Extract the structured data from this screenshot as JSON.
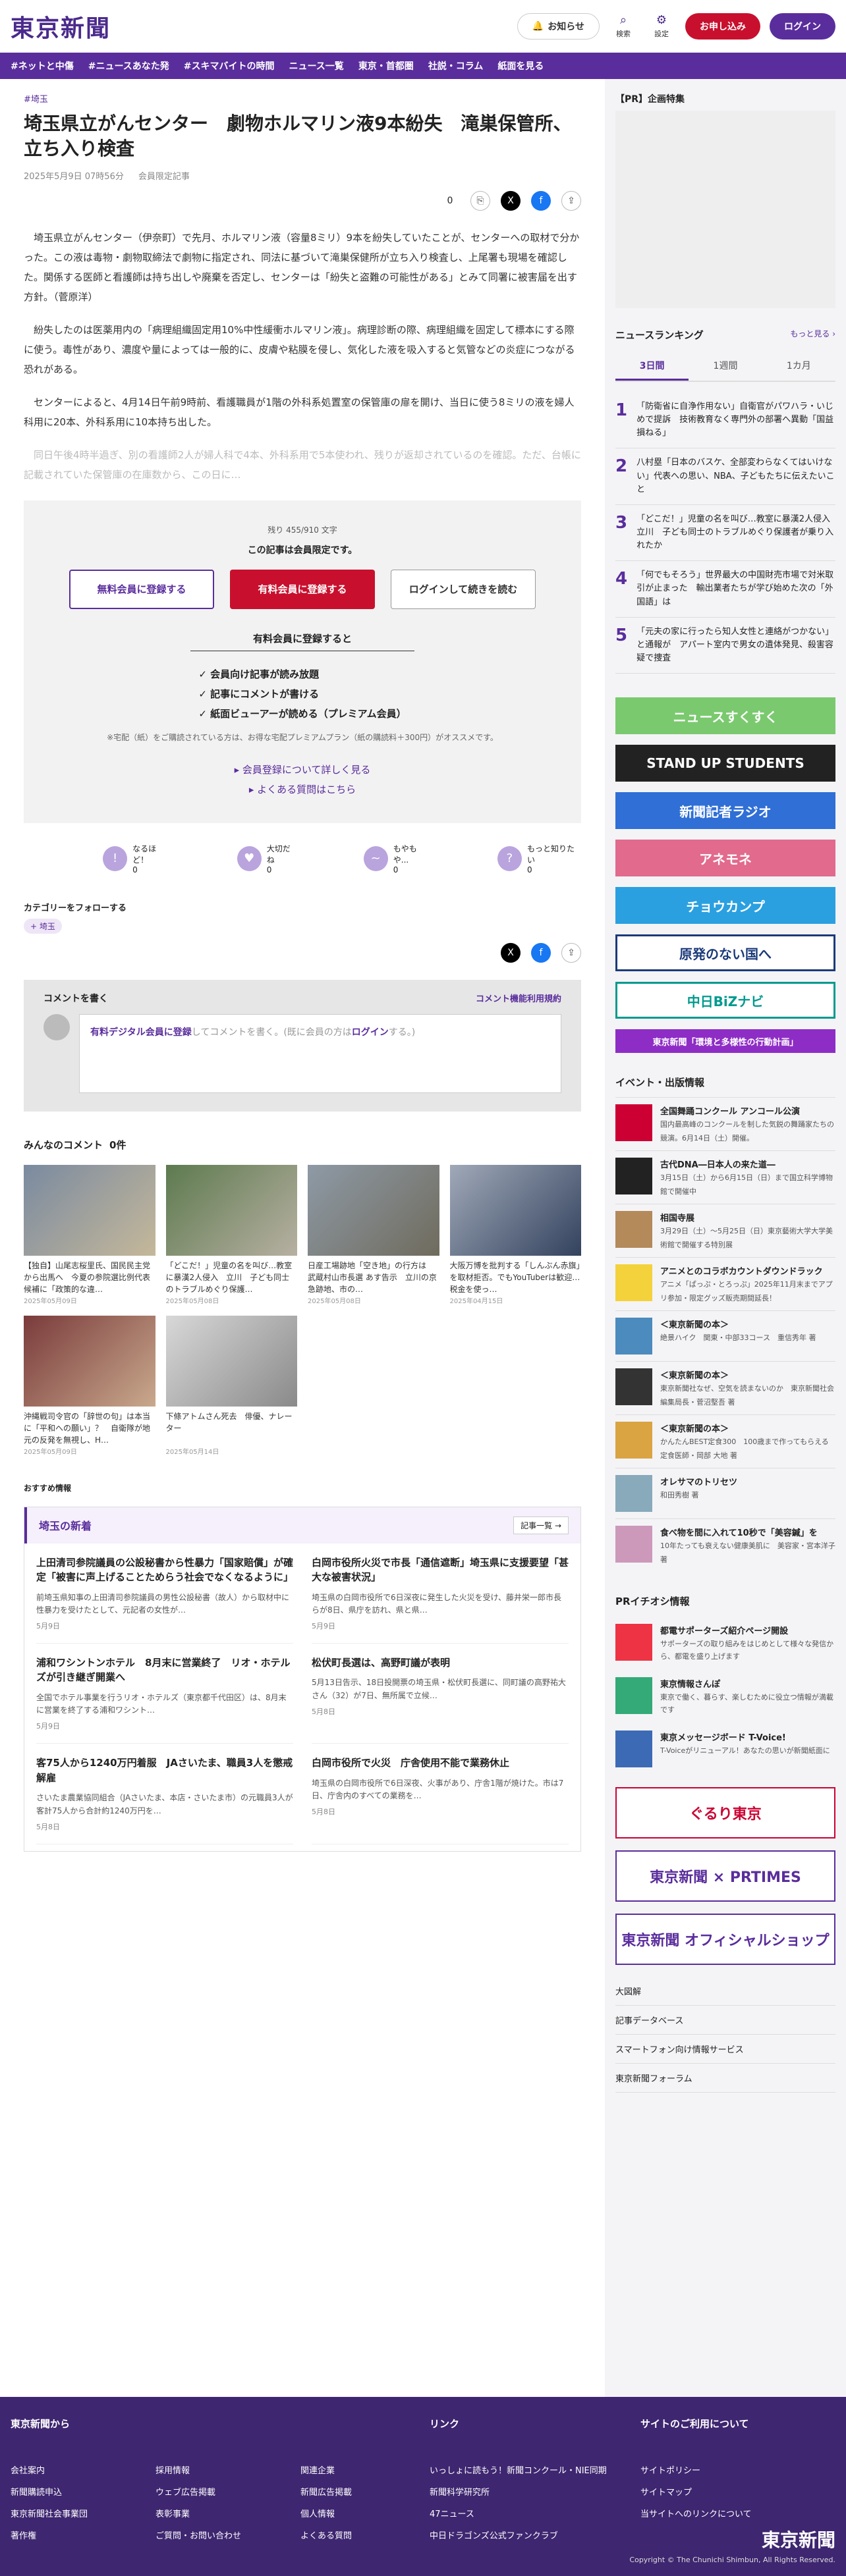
{
  "header": {
    "logo": "東京新聞",
    "notify": "お知らせ",
    "search": "検索",
    "settings": "設定",
    "apply": "お申し込み",
    "login": "ログイン"
  },
  "nav": [
    "#ネットと中傷",
    "#ニュースあなた発",
    "#スキマバイトの時間",
    "ニュース一覧",
    "東京・首都圏",
    "社説・コラム",
    "紙面を見る"
  ],
  "article": {
    "category": "#埼玉",
    "title": "埼玉県立がんセンター　劇物ホルマリン液9本紛失　滝巣保管所、立ち入り検査",
    "date": "2025年5月9日 07時56分",
    "member": "会員限定記事",
    "comments": "0",
    "paras": [
      "埼玉県立がんセンター（伊奈町）で先月、ホルマリン液（容量8ミリ）9本を紛失していたことが、センターへの取材で分かった。この液は毒物・劇物取締法で劇物に指定され、同法に基づいて滝巣保健所が立ち入り検査し、上尾署も現場を確認した。関係する医師と看護師は持ち出しや廃棄を否定し、センターは「紛失と盗難の可能性がある」とみて同署に被害届を出す方針。（菅原洋）",
      "紛失したのは医薬用内の「病理組織固定用10%中性緩衝ホルマリン液」。病理診断の際、病理組織を固定して標本にする際に使う。毒性があり、濃度や量によっては一般的に、皮膚や粘膜を侵し、気化した液を吸入すると気管などの炎症につながる恐れがある。",
      "センターによると、4月14日午前9時前、看護職員が1階の外科系処置室の保管庫の扉を開け、当日に使う8ミリの液を婦人科用に20本、外科系用に10本持ち出した。",
      "同日午後4時半過ぎ、別の看護師2人が婦人科で4本、外科系用で5本使われ、残りが返却されているのを確認。ただ、台帳に記載されていた保管庫の在庫数から、この日に…"
    ]
  },
  "paywall": {
    "remain": "残り 455/910 文字",
    "lead": "この記事は会員限定です。",
    "free": "無料会員に登録する",
    "paid": "有料会員に登録する",
    "login": "ログインして続きを読む",
    "benefit_h": "有料会員に登録すると",
    "benefits": [
      "✓ 会員向け記事が読み放題",
      "✓ 記事にコメントが書ける",
      "✓ 紙面ビューアーが読める（プレミアム会員）"
    ],
    "note": "※宅配（紙）をご購読されている方は、お得な宅配プレミアムプラン（紙の購読料＋300円）がオススメです。",
    "link1": "▸ 会員登録について詳しく見る",
    "link2": "▸ よくある質問はこちら"
  },
  "reacts": [
    [
      "なるほど！",
      "0"
    ],
    [
      "大切だね",
      "0"
    ],
    [
      "もやもや...",
      "0"
    ],
    [
      "もっと知りたい",
      "0"
    ]
  ],
  "follow": {
    "label": "カテゴリーをフォローする",
    "tag": "+ 埼玉"
  },
  "comment": {
    "label": "コメントを書く",
    "rules": "コメント機能利用規約",
    "prompt_a": "有料デジタル会員に登録",
    "prompt_b": "してコメントを書く。(既に会員の方は",
    "prompt_c": "ログイン",
    "prompt_d": "する。)"
  },
  "everyone": {
    "label": "みんなのコメント",
    "count": "0件"
  },
  "thumbs": [
    [
      "【独自】山尾志桜里氏、国民民主党から出馬へ　今夏の参院選比例代表候補に「政策的な違…",
      "2025年05月09日"
    ],
    [
      "「どこだ！」児童の名を叫び…教室に暴漢2人侵入　立川　子ども同士のトラブルめぐり保護…",
      "2025年05月08日"
    ],
    [
      "日産工場跡地「空き地」の行方は　武蔵村山市長選 あす告示　立川の京急跡地、市の…",
      "2025年05月08日"
    ],
    [
      "大阪万博を批判する「しんぶん赤旗」を取材拒否。でもYouTuberは歓迎…税金を使っ…",
      "2025年04月15日"
    ],
    [
      "沖縄戦司令官の「辞世の句」は本当に「平和への願い」？　自衛隊が地元の反発を無視し、H…",
      "2025年05月09日"
    ],
    [
      "下條アトムさん死去　俳優、ナレーター",
      "2025年05月14日"
    ]
  ],
  "osusume": "おすすめ情報",
  "local": {
    "title": "埼玉の新着",
    "more": "記事一覧 →",
    "items": [
      [
        "上田清司参院議員の公設秘書から性暴力「国家賠償」が確定「被害に声上げることためらう社会でなくなるように」",
        "前埼玉県知事の上田清司参院議員の男性公設秘書（故人）から取材中に性暴力を受けたとして、元記者の女性が…",
        "5月9日"
      ],
      [
        "白岡市役所火災で市長「通信遮断」埼玉県に支援要望「甚大な被害状況」",
        "埼玉県の白岡市役所で6日深夜に発生した火災を受け、藤井栄一郎市長らが8日、県庁を訪れ、県と県…",
        "5月9日"
      ],
      [
        "浦和ワシントンホテル　8月末に営業終了　リオ・ホテルズが引き継ぎ開業へ",
        "全国でホテル事業を行うリオ・ホテルズ（東京都千代田区）は、8月末に営業を終了する浦和ワシント…",
        "5月9日"
      ],
      [
        "松伏町長選は、高野町議が表明",
        "5月13日告示、18日投開票の埼玉県・松伏町長選に、同町議の高野祐大さん（32）が7日、無所属で立候…",
        "5月8日"
      ],
      [
        "客75人から1240万円着服　JAさいたま、職員3人を懲戒解雇",
        "さいたま農業協同組合（JAさいたま、本店・さいたま市）の元職員3人が客計75人から合計約1240万円を…",
        "5月8日"
      ],
      [
        "白岡市役所で火災　庁舎使用不能で業務休止",
        "埼玉県の白岡市役所で6日深夜、火事があり、庁舎1階が焼けた。市は7日、庁舎内のすべての業務を…",
        "5月8日"
      ]
    ]
  },
  "side": {
    "ad": "【PR】企画特集",
    "rank_h": "ニュースランキング",
    "rank_more": "もっと見る ›",
    "tabs": [
      "3日間",
      "1週間",
      "1カ月"
    ],
    "ranking": [
      "「防衛省に自浄作用ない」自衛官がパワハラ・いじめで提訴　技術教育なく専門外の部署へ異動「国益損ねる」",
      "八村塁「日本のバスケ、全部変わらなくてはいけない」代表への思い、NBA、子どもたちに伝えたいこと",
      "「どこだ！」児童の名を叫び…教室に暴漢2人侵入　立川　子ども同士のトラブルめぐり保護者が乗り入れたか",
      "「何でもそろう」世界最大の中国財売市場で対米取引が止まった　輸出業者たちが学び始めた次の「外国語」は",
      "「元夫の家に行ったら知人女性と連絡がつかない」と通報が　アパート室内で男女の遺体発見、殺害容疑で捜査"
    ],
    "banners": [
      "ニュースすくすく",
      "STAND UP STUDENTS",
      "新聞記者ラジオ",
      "アネモネ",
      "チョウカンプ",
      "原発のない国へ",
      "中日BiZナビ",
      "東京新聞「環境と多様性の行動計画」"
    ],
    "ev_h": "イベント・出版情報",
    "events": [
      [
        "全国舞踊コンクール アンコール公演",
        "国内最高峰のコンクールを制した気鋭の舞踊家たちの競演。6月14日（土）開催。"
      ],
      [
        "古代DNA―日本人の来た道―",
        "3月15日（土）から6月15日（日）まで国立科学博物館で開催中"
      ],
      [
        "相国寺展",
        "3月29日（土）～5月25日（日）東京藝術大学大学美術館で開催する特別展"
      ],
      [
        "アニメとのコラボカウントダウンドラック",
        "アニメ「ぱっぷ・とろっぷ」2025年11月末までアプリ参加・限定グッズ販売期間延長！"
      ],
      [
        "＜東京新聞の本＞",
        "絶景ハイク　関東・中部33コース　重信秀年 著"
      ],
      [
        "＜東京新聞の本＞",
        "東京新聞社なぜ、空気を読まないのか　東京新聞社会編集局長・菅沼堅吾 著"
      ],
      [
        "＜東京新聞の本＞",
        "かんたんBEST定食300　100歳まで作ってもらえる　定食医師・岡部 大地 著"
      ],
      [
        "オレサマのトリセツ",
        "和田秀樹 著"
      ],
      [
        "食べ物を間に入れて10秒で「美容鍼」を",
        "10年たっても衰えない健康美肌に　美容家・宮本洋子 著"
      ]
    ],
    "pr_h": "PRイチオシ情報",
    "pr": [
      [
        "都電サポーターズ紹介ページ開設",
        "サポーターズの取り組みをはじめとして様々な発信から、都電を盛り上げます"
      ],
      [
        "東京情報さんぽ",
        "東京で働く、暮らす、楽しむために役立つ情報が満載です"
      ],
      [
        "東京メッセージボード T-Voice!",
        "T-Voiceがリニューアル！あなたの思いが新聞紙面に"
      ]
    ],
    "big": [
      "ぐるり東京",
      "東京新聞 × PRTIMES",
      "東京新聞 オフィシャルショップ"
    ],
    "slinks": [
      "大図解",
      "記事データベース",
      "スマートフォン向け情報サービス",
      "東京新聞フォーラム"
    ]
  },
  "footer": {
    "c1": "東京新聞から",
    "c2": "リンク",
    "c3": "サイトのご利用について",
    "l1": [
      "会社案内",
      "新聞購読申込",
      "東京新聞社会事業団",
      "著作権",
      "採用情報",
      "ウェブ広告掲載",
      "表彰事業",
      "ご質問・お問い合わせ",
      "関連企業",
      "新聞広告掲載",
      "個人情報",
      "よくある質問"
    ],
    "l2": [
      "いっしょに読もう！新聞コンクール・NIE同期",
      "新聞科学研究所",
      "47ニュース",
      "中日ドラゴンズ公式ファンクラブ"
    ],
    "l3": [
      "サイトポリシー",
      "サイトマップ",
      "当サイトへのリンクについて"
    ],
    "logo": "東京新聞",
    "copy": "Copyright © The Chunichi Shimbun, All Rights Reserved."
  },
  "colors": {
    "brand": "#5a2d9c",
    "red": "#c8102e"
  }
}
